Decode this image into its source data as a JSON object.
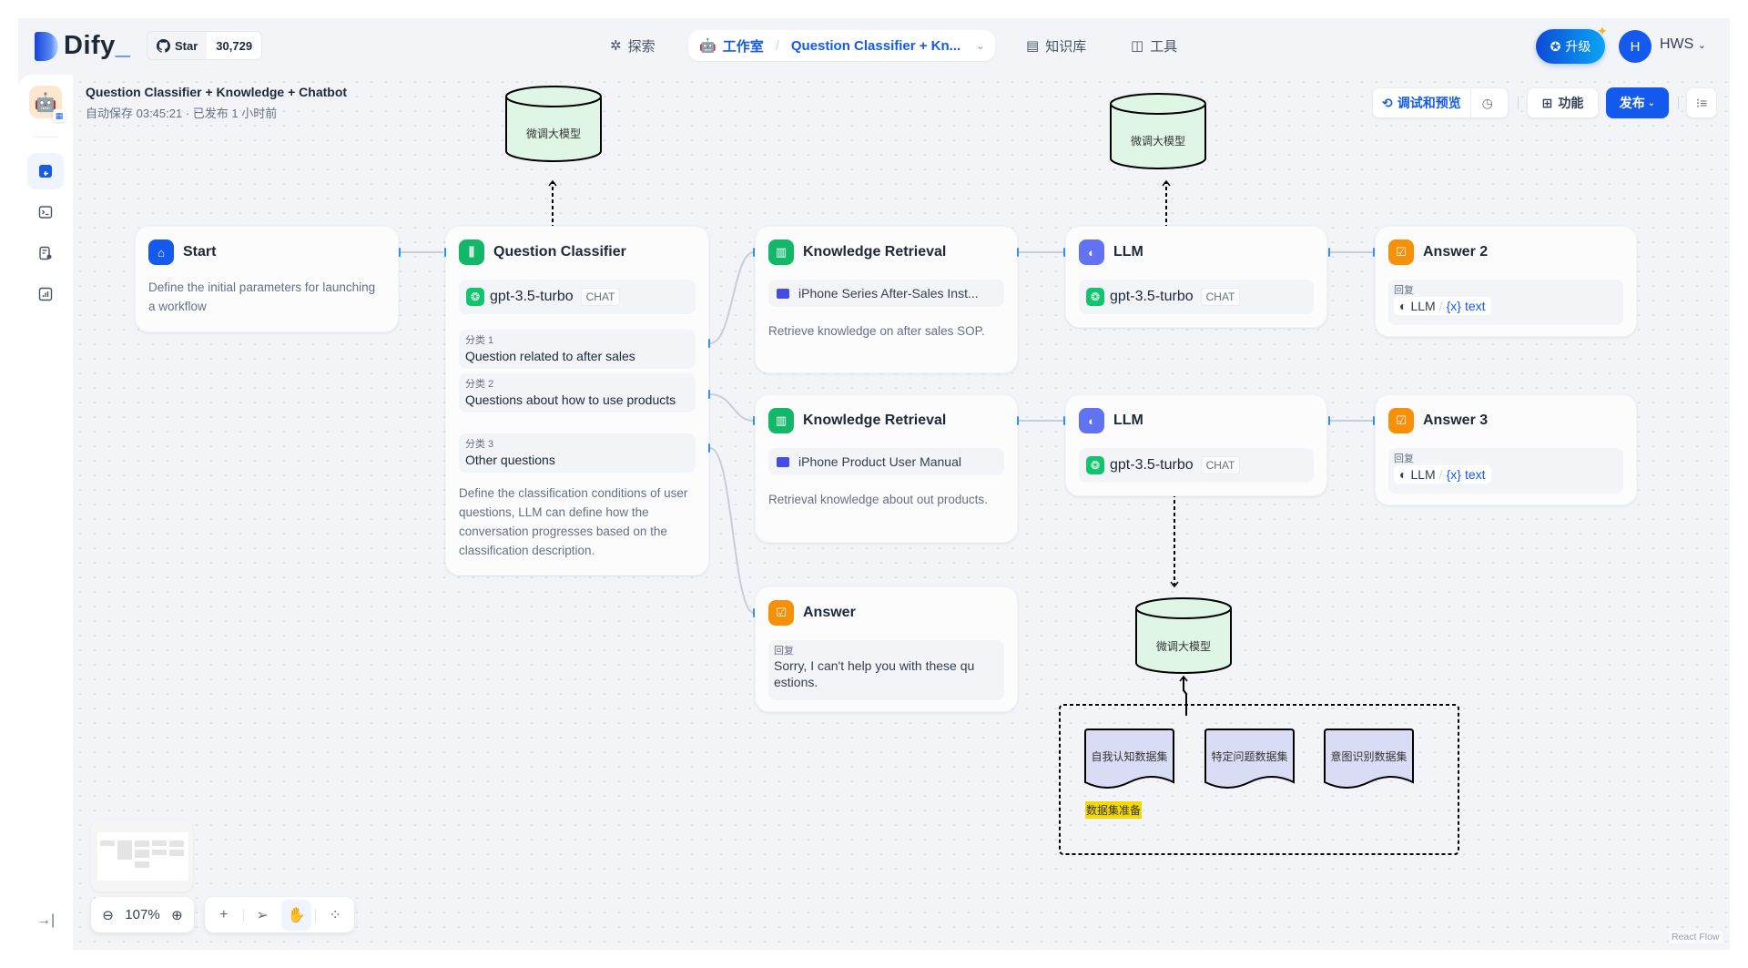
{
  "header": {
    "logo_text": "Dify",
    "github": {
      "label": "Star",
      "count": "30,729"
    },
    "nav": [
      {
        "label": "探索",
        "icon": "explore-icon"
      },
      {
        "label": "工作室",
        "icon": "studio-robot-icon",
        "active": true,
        "breadcrumb": "Question Classifier + Kn..."
      },
      {
        "label": "知识库",
        "icon": "knowledge-book-icon"
      },
      {
        "label": "工具",
        "icon": "tools-icon"
      }
    ],
    "upgrade_label": "升级",
    "user": {
      "initial": "H",
      "name": "HWS"
    }
  },
  "app": {
    "title": "Question Classifier + Knowledge + Chatbot",
    "status": "自动保存 03:45:21 · 已发布 1 小时前"
  },
  "toolbar": {
    "debug_label": "调试和预览",
    "features_label": "功能",
    "publish_label": "发布"
  },
  "nodes": {
    "start": {
      "title": "Start",
      "desc": "Define the initial parameters for launching a workflow"
    },
    "classifier": {
      "title": "Question Classifier",
      "model": "gpt-3.5-turbo",
      "mode": "CHAT",
      "classes": [
        {
          "label": "分类 1",
          "text": "Question related to after sales"
        },
        {
          "label": "分类 2",
          "text": "Questions about how to use products"
        },
        {
          "label": "分类 3",
          "text": "Other questions"
        }
      ],
      "desc": "Define the classification conditions of user questions, LLM can define how the conversation progresses based on the classification description."
    },
    "kr1": {
      "title": "Knowledge Retrieval",
      "dataset": "iPhone Series After-Sales Inst...",
      "desc": "Retrieve knowledge on after sales SOP."
    },
    "kr2": {
      "title": "Knowledge Retrieval",
      "dataset": "iPhone Product User Manual",
      "desc": "Retrieval knowledge about out products."
    },
    "llm1": {
      "title": "LLM",
      "model": "gpt-3.5-turbo",
      "mode": "CHAT"
    },
    "llm2": {
      "title": "LLM",
      "model": "gpt-3.5-turbo",
      "mode": "CHAT"
    },
    "answer2": {
      "title": "Answer 2",
      "label": "回复",
      "var_node": "LLM",
      "var_name": "text"
    },
    "answer3": {
      "title": "Answer 3",
      "label": "回复",
      "var_node": "LLM",
      "var_name": "text"
    },
    "answer": {
      "title": "Answer",
      "label": "回复",
      "text": "Sorry, I can't help you with these qu estions."
    }
  },
  "annotations": {
    "cylinder_label": "微调大模型",
    "datasets": [
      "自我认知数据集",
      "特定问题数据集",
      "意图识别数据集"
    ],
    "group_label": "数据集准备"
  },
  "controls": {
    "zoom": "107%",
    "attribution": "React Flow"
  }
}
